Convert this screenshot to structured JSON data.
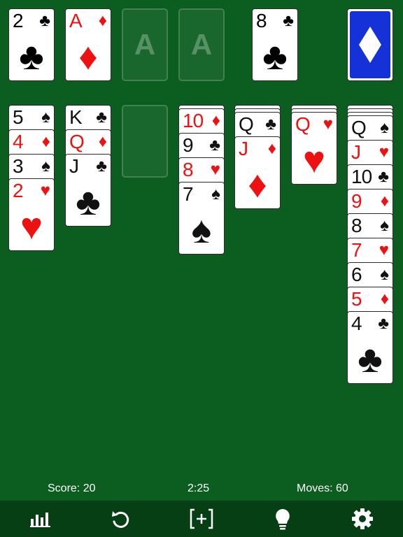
{
  "top_row": {
    "waste": [
      {
        "rank": "2",
        "suit": "♣",
        "color": "black"
      },
      {
        "rank": "A",
        "suit": "♦",
        "color": "red"
      }
    ],
    "foundations": [
      {
        "label": "A"
      },
      {
        "label": "A"
      },
      {
        "rank": "8",
        "suit": "♣",
        "color": "black"
      }
    ],
    "stock": {
      "back_symbol": "♦"
    }
  },
  "tableau": [
    [
      {
        "rank": "5",
        "suit": "♠",
        "color": "black"
      },
      {
        "rank": "4",
        "suit": "♦",
        "color": "red"
      },
      {
        "rank": "3",
        "suit": "♠",
        "color": "black"
      },
      {
        "rank": "2",
        "suit": "♥",
        "color": "red"
      }
    ],
    [
      {
        "rank": "K",
        "suit": "♣",
        "color": "black"
      },
      {
        "rank": "Q",
        "suit": "♦",
        "color": "red"
      },
      {
        "rank": "J",
        "suit": "♣",
        "color": "black"
      }
    ],
    [],
    [
      {
        "rank": "10",
        "suit": "♦",
        "color": "red"
      },
      {
        "rank": "9",
        "suit": "♣",
        "color": "black"
      },
      {
        "rank": "8",
        "suit": "♥",
        "color": "red"
      },
      {
        "rank": "7",
        "suit": "♠",
        "color": "black"
      }
    ],
    [
      {
        "rank": "Q",
        "suit": "♣",
        "color": "black"
      },
      {
        "rank": "J",
        "suit": "♦",
        "color": "red"
      }
    ],
    [
      {
        "rank": "Q",
        "suit": "♥",
        "color": "red"
      }
    ],
    [
      {
        "rank": "Q",
        "suit": "♠",
        "color": "black"
      },
      {
        "rank": "J",
        "suit": "♥",
        "color": "red"
      },
      {
        "rank": "10",
        "suit": "♣",
        "color": "black"
      },
      {
        "rank": "9",
        "suit": "♦",
        "color": "red"
      },
      {
        "rank": "8",
        "suit": "♠",
        "color": "black"
      },
      {
        "rank": "7",
        "suit": "♥",
        "color": "red"
      },
      {
        "rank": "6",
        "suit": "♠",
        "color": "black"
      },
      {
        "rank": "5",
        "suit": "♦",
        "color": "red"
      },
      {
        "rank": "4",
        "suit": "♣",
        "color": "black"
      }
    ]
  ],
  "hidden_counts": [
    0,
    0,
    0,
    1,
    2,
    2,
    3
  ],
  "status": {
    "score": "Score: 20",
    "time": "2:25",
    "moves": "Moves: 60"
  },
  "toolbar": [
    {
      "icon": "stats-icon"
    },
    {
      "icon": "undo-icon"
    },
    {
      "icon": "new-game-icon"
    },
    {
      "icon": "hint-icon"
    },
    {
      "icon": "settings-icon"
    }
  ],
  "colors": {
    "felt": "#0b5e1f",
    "toolbar": "#063f14",
    "red": "#ee1111",
    "black": "#111111",
    "card_back": "#1432d8"
  }
}
